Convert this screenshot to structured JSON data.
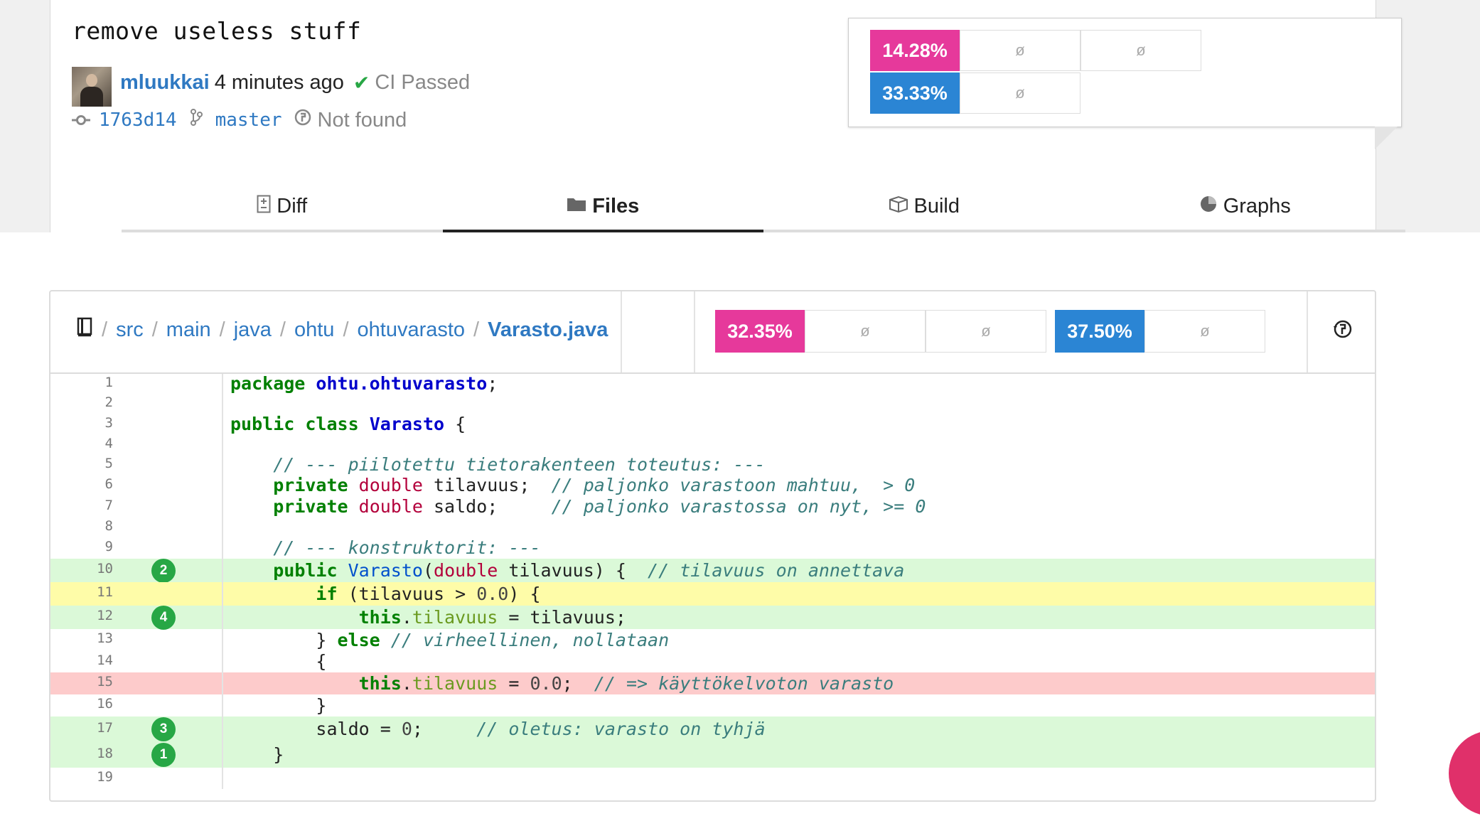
{
  "commit": {
    "title": "remove useless stuff",
    "author": "mluukkai",
    "time_ago": "4 minutes ago",
    "ci_status": "CI Passed",
    "sha": "1763d14",
    "branch": "master",
    "build": "Not found"
  },
  "coverage_top": {
    "row1": {
      "badge": "14.28%",
      "cells": [
        "ø",
        "ø"
      ]
    },
    "row2": {
      "badge": "33.33%",
      "cells": [
        "ø"
      ]
    },
    "colors": {
      "pink": "#e6399b",
      "blue": "#2b85d4"
    }
  },
  "tabs": [
    {
      "label": "Diff",
      "icon": "diff-file-icon",
      "active": false
    },
    {
      "label": "Files",
      "icon": "folder-icon",
      "active": true
    },
    {
      "label": "Build",
      "icon": "box-icon",
      "active": false
    },
    {
      "label": "Graphs",
      "icon": "pie-chart-icon",
      "active": false
    }
  ],
  "file": {
    "breadcrumb": [
      "src",
      "main",
      "java",
      "ohtu",
      "ohtuvarasto",
      "Varasto.java"
    ],
    "coverage": {
      "pink_badge": "32.35%",
      "pink_cells": [
        "ø",
        "ø"
      ],
      "blue_badge": "37.50%",
      "blue_cells": [
        "ø"
      ]
    }
  },
  "code_lines": [
    {
      "n": "1",
      "status": "",
      "hits": "",
      "tokens": [
        [
          "kw",
          "package"
        ],
        [
          "pl",
          " "
        ],
        [
          "nm",
          "ohtu.ohtuvarasto"
        ],
        [
          "pl",
          ";"
        ]
      ]
    },
    {
      "n": "2",
      "status": "",
      "hits": "",
      "tokens": []
    },
    {
      "n": "3",
      "status": "",
      "hits": "",
      "tokens": [
        [
          "kw",
          "public class"
        ],
        [
          "pl",
          " "
        ],
        [
          "nm",
          "Varasto"
        ],
        [
          "pl",
          " {"
        ]
      ]
    },
    {
      "n": "4",
      "status": "",
      "hits": "",
      "tokens": []
    },
    {
      "n": "5",
      "status": "",
      "hits": "",
      "tokens": [
        [
          "pl",
          "    "
        ],
        [
          "cm",
          "// --- piilotettu tietorakenteen toteutus: ---"
        ]
      ]
    },
    {
      "n": "6",
      "status": "",
      "hits": "",
      "tokens": [
        [
          "pl",
          "    "
        ],
        [
          "kw",
          "private"
        ],
        [
          "pl",
          " "
        ],
        [
          "ty",
          "double"
        ],
        [
          "pl",
          " tilavuus;  "
        ],
        [
          "cm",
          "// paljonko varastoon mahtuu,  > 0"
        ]
      ]
    },
    {
      "n": "7",
      "status": "",
      "hits": "",
      "tokens": [
        [
          "pl",
          "    "
        ],
        [
          "kw",
          "private"
        ],
        [
          "pl",
          " "
        ],
        [
          "ty",
          "double"
        ],
        [
          "pl",
          " saldo;     "
        ],
        [
          "cm",
          "// paljonko varastossa on nyt, >= 0"
        ]
      ]
    },
    {
      "n": "8",
      "status": "",
      "hits": "",
      "tokens": []
    },
    {
      "n": "9",
      "status": "",
      "hits": "",
      "tokens": [
        [
          "pl",
          "    "
        ],
        [
          "cm",
          "// --- konstruktorit: ---"
        ]
      ]
    },
    {
      "n": "10",
      "status": "g",
      "hits": "2",
      "tokens": [
        [
          "pl",
          "    "
        ],
        [
          "kw",
          "public"
        ],
        [
          "pl",
          " "
        ],
        [
          "fn",
          "Varasto"
        ],
        [
          "pl",
          "("
        ],
        [
          "ty",
          "double"
        ],
        [
          "pl",
          " tilavuus) {  "
        ],
        [
          "cm",
          "// tilavuus on annettava"
        ]
      ]
    },
    {
      "n": "11",
      "status": "y",
      "hits": "",
      "tokens": [
        [
          "pl",
          "        "
        ],
        [
          "kw",
          "if"
        ],
        [
          "pl",
          " (tilavuus > "
        ],
        [
          "nu",
          "0.0"
        ],
        [
          "pl",
          ") {"
        ]
      ]
    },
    {
      "n": "12",
      "status": "g",
      "hits": "4",
      "tokens": [
        [
          "pl",
          "            "
        ],
        [
          "kw",
          "this"
        ],
        [
          "pl",
          "."
        ],
        [
          "fld",
          "tilavuus"
        ],
        [
          "pl",
          " = tilavuus;"
        ]
      ]
    },
    {
      "n": "13",
      "status": "",
      "hits": "",
      "tokens": [
        [
          "pl",
          "        } "
        ],
        [
          "kw",
          "else"
        ],
        [
          "pl",
          " "
        ],
        [
          "cm",
          "// virheellinen, nollataan"
        ]
      ]
    },
    {
      "n": "14",
      "status": "",
      "hits": "",
      "tokens": [
        [
          "pl",
          "        {"
        ]
      ]
    },
    {
      "n": "15",
      "status": "r",
      "hits": "",
      "tokens": [
        [
          "pl",
          "            "
        ],
        [
          "kw",
          "this"
        ],
        [
          "pl",
          "."
        ],
        [
          "fld",
          "tilavuus"
        ],
        [
          "pl",
          " = "
        ],
        [
          "nu",
          "0.0"
        ],
        [
          "pl",
          ";  "
        ],
        [
          "cm",
          "// => käyttökelvoton varasto"
        ]
      ]
    },
    {
      "n": "16",
      "status": "",
      "hits": "",
      "tokens": [
        [
          "pl",
          "        }"
        ]
      ]
    },
    {
      "n": "17",
      "status": "g",
      "hits": "3",
      "tokens": [
        [
          "pl",
          "        saldo = "
        ],
        [
          "nu",
          "0"
        ],
        [
          "pl",
          ";     "
        ],
        [
          "cm",
          "// oletus: varasto on tyhjä"
        ]
      ]
    },
    {
      "n": "18",
      "status": "g",
      "hits": "1",
      "tokens": [
        [
          "pl",
          "    }"
        ]
      ]
    },
    {
      "n": "19",
      "status": "",
      "hits": "",
      "tokens": []
    }
  ]
}
